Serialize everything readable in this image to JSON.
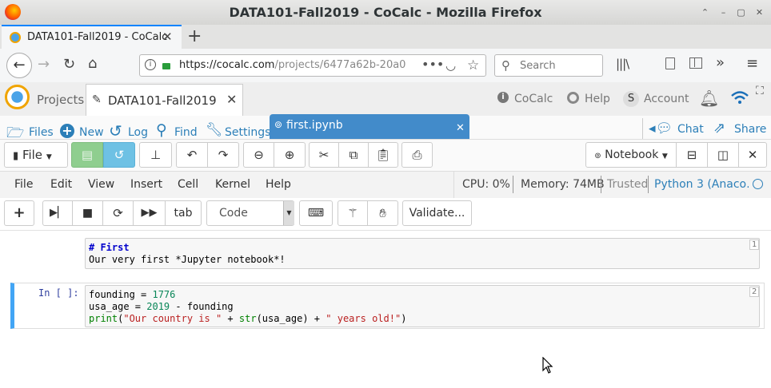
{
  "window": {
    "title": "DATA101-Fall2019 - CoCalc - Mozilla Firefox"
  },
  "browser": {
    "tab_title": "DATA101-Fall2019 - CoCalc",
    "url": "https://cocalc.com/projects/6477a62b-20a0",
    "url_host": "https://cocalc.com",
    "url_path": "/projects/6477a62b-20a0",
    "search_placeholder": "Search"
  },
  "cocalc_top": {
    "projects_label": "Projects",
    "project_tab": "DATA101-Fall2019",
    "cocalc_label": "CoCalc",
    "help_label": "Help",
    "account_initial": "S",
    "account_label": "Account"
  },
  "file_row": {
    "files": "Files",
    "new": "New",
    "log": "Log",
    "find": "Find",
    "settings": "Settings",
    "open_file": "first.ipynb",
    "chat": "Chat",
    "share": "Share"
  },
  "toolbar": {
    "file_label": "File",
    "notebook_label": "Notebook"
  },
  "menubar": {
    "items": [
      "File",
      "Edit",
      "View",
      "Insert",
      "Cell",
      "Kernel",
      "Help"
    ],
    "cpu": "CPU: 0%",
    "memory": "Memory: 74MB",
    "trusted": "Trusted",
    "kernel": "Python 3 (Anaco…"
  },
  "toolrow": {
    "tab_label": "tab",
    "cell_type": "Code",
    "validate_label": "Validate..."
  },
  "cells": [
    {
      "number": "1",
      "lines": [
        "# First",
        "Our very first *Jupyter notebook*!"
      ]
    },
    {
      "number": "2",
      "prompt": "In [ ]:",
      "lines": [
        "founding = 1776",
        "usa_age = 2019 - founding",
        "print(\"Our country is \" + str(usa_age) + \" years old!\")"
      ]
    }
  ],
  "colors": {
    "accent": "#428bca",
    "firefox_blue": "#0a84ff",
    "save_green": "#8fce8f",
    "history_teal": "#6ec1e4"
  }
}
